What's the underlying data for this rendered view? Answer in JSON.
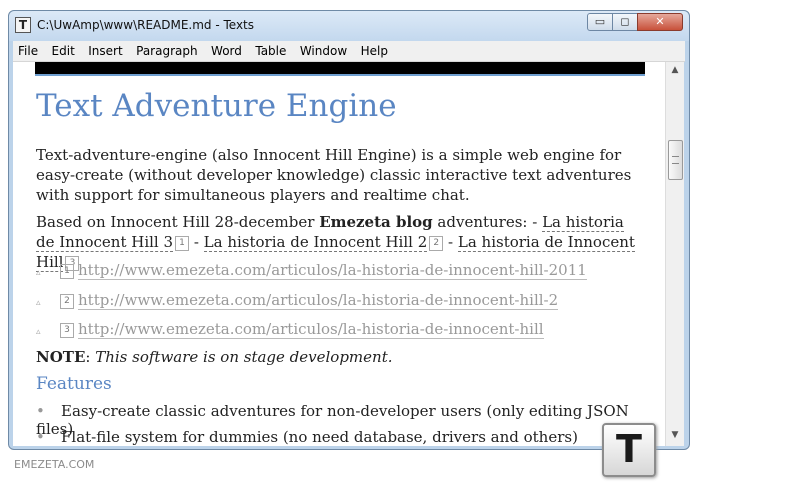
{
  "window": {
    "title": "C:\\UwAmp\\www\\README.md - Texts",
    "icon": "T",
    "buttons": {
      "minimize": "▭",
      "maximize": "◻",
      "close": "✕"
    }
  },
  "menu": [
    "File",
    "Edit",
    "Insert",
    "Paragraph",
    "Word",
    "Table",
    "Window",
    "Help"
  ],
  "document": {
    "heading": "Text Adventure Engine",
    "intro": "Text-adventure-engine (also Innocent Hill Engine) is a simple web engine for easy-create (without developer knowledge) classic interactive text adventures with support for simultaneous players and realtime chat.",
    "based_prefix": "Based on Innocent Hill 28-december ",
    "based_bold": "Emezeta blog",
    "based_mid": " adventures: - ",
    "link1": "La historia de Innocent Hill 3",
    "ref1": "1",
    "sep1": " - ",
    "link2": "La historia de Innocent Hill 2",
    "ref2": "2",
    "sep2": " - ",
    "link3": "La historia de Innocent Hill",
    "ref3": "3",
    "references": [
      {
        "num": "1",
        "url": "http://www.emezeta.com/articulos/la-historia-de-innocent-hill-2011"
      },
      {
        "num": "2",
        "url": "http://www.emezeta.com/articulos/la-historia-de-innocent-hill-2"
      },
      {
        "num": "3",
        "url": "http://www.emezeta.com/articulos/la-historia-de-innocent-hill"
      }
    ],
    "note_label": "NOTE",
    "note_colon": ": ",
    "note_text": "This software is on stage development.",
    "features_heading": "Features",
    "features": [
      "Easy-create classic adventures for non-developer users (only editing JSON files)",
      "Flat-file system for dummies (no need database, drivers and others)"
    ]
  },
  "badge_letter": "T",
  "footer": "EMEZETA.COM",
  "icons": {
    "ref_marker": "▵",
    "bullet": "•",
    "scroll_up": "▲",
    "scroll_down": "▼"
  }
}
